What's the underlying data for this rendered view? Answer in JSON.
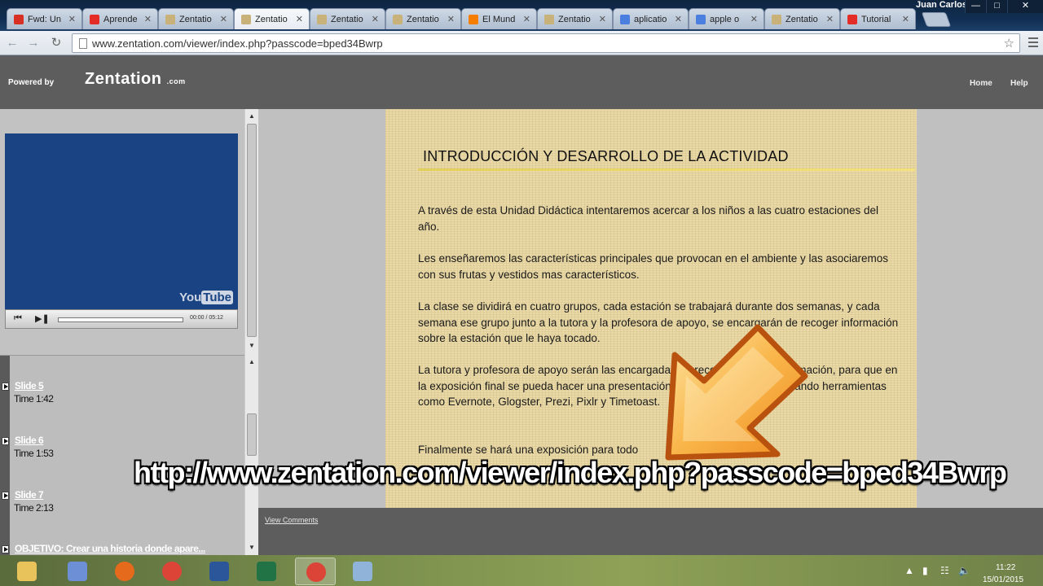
{
  "browser": {
    "user_name": "Juan Carlos",
    "tabs": [
      {
        "label": "Fwd: Un",
        "icon": "gmail-icon",
        "color": "#d93025"
      },
      {
        "label": "Aprende",
        "icon": "youtube-icon",
        "color": "#e52d27"
      },
      {
        "label": "Zentatio",
        "icon": "zentation-icon",
        "color": "#c8b27a"
      },
      {
        "label": "Zentatio",
        "icon": "zentation-icon",
        "color": "#c8b27a",
        "active": true
      },
      {
        "label": "Zentatio",
        "icon": "zentation-icon",
        "color": "#c8b27a"
      },
      {
        "label": "Zentatio",
        "icon": "zentation-icon",
        "color": "#c8b27a"
      },
      {
        "label": "El Mund",
        "icon": "blogger-icon",
        "color": "#f57d00"
      },
      {
        "label": "Zentatio",
        "icon": "zentation-icon",
        "color": "#c8b27a"
      },
      {
        "label": "aplicatio",
        "icon": "google-icon",
        "color": "#4a7fe0"
      },
      {
        "label": "apple o",
        "icon": "google-icon",
        "color": "#4a7fe0"
      },
      {
        "label": "Zentatio",
        "icon": "zentation-icon",
        "color": "#c8b27a"
      },
      {
        "label": "Tutorial",
        "icon": "youtube-icon",
        "color": "#e52d27"
      }
    ],
    "url": "www.zentation.com/viewer/index.php?passcode=bped34Bwrp"
  },
  "header": {
    "powered_by": "Powered by",
    "logo": "Zentation",
    "logo_suffix": ".com",
    "nav": {
      "home": "Home",
      "help": "Help"
    }
  },
  "video": {
    "brand": "You",
    "brand_box": "Tube",
    "time": "00:00 / 05:12"
  },
  "slides": [
    {
      "name": "Slide 5",
      "time": "Time 1:42"
    },
    {
      "name": "Slide 6",
      "time": "Time 1:53"
    },
    {
      "name": "Slide 7",
      "time": "Time 2:13"
    },
    {
      "name": "OBJETIVO: Crear una historia donde apare...",
      "time": ""
    }
  ],
  "slide": {
    "title": "INTRODUCCIÓN Y DESARROLLO DE LA ACTIVIDAD",
    "paragraphs": [
      "A través de esta Unidad Didáctica intentaremos acercar a los niños a las cuatro estaciones del año.",
      "Les  enseñaremos las características principales que provocan en el ambiente y las asociaremos con sus frutas y vestidos mas característicos.",
      "La clase se dividirá en cuatro grupos, cada estación se trabajará durante dos semanas, y cada semana ese grupo junto a la tutora y la profesora de apoyo, se encargarán de recoger información sobre la estación que le haya tocado.",
      "La tutora y profesora de apoyo serán las encargadas de recopilar todo la información, para que en la exposición final se pueda hacer una presentación en la pizarra digital, utilizando herramientas como Evernote, Glogster, Prezi, Pixlr y Timetoast.",
      "Finalmente se hará una exposición para todo"
    ]
  },
  "comments_link": "View Comments",
  "overlay_url": "http://www.zentation.com/viewer/index.php?passcode=bped34Bwrp",
  "taskbar": {
    "apps": [
      {
        "name": "file-explorer-icon",
        "color": "#e8c25a"
      },
      {
        "name": "network-icon",
        "color": "#6c8fd6"
      },
      {
        "name": "firefox-icon",
        "color": "#e66a1c"
      },
      {
        "name": "chrome-icon",
        "color": "#db4437"
      },
      {
        "name": "word-icon",
        "color": "#2b579a"
      },
      {
        "name": "excel-icon",
        "color": "#217346"
      },
      {
        "name": "chrome-icon",
        "color": "#db4437",
        "active": true
      },
      {
        "name": "paint-icon",
        "color": "#8fb3d9"
      }
    ],
    "clock_time": "11:22",
    "clock_date": "15/01/2015"
  }
}
